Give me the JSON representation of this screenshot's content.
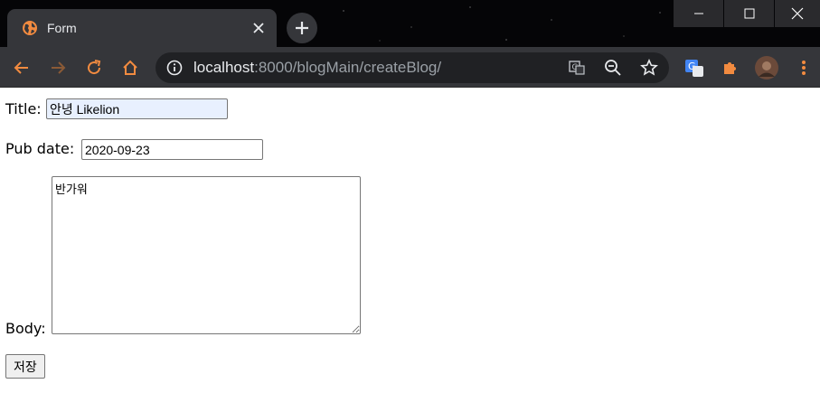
{
  "browser": {
    "tab_title": "Form",
    "url_host": "localhost",
    "url_rest": ":8000/blogMain/createBlog/",
    "colors": {
      "accent": "#f28b40",
      "frame": "#35363a",
      "omnibox": "#202124"
    }
  },
  "form": {
    "title_label": "Title:",
    "title_value": "안녕 Likelion",
    "pub_date_label": "Pub date:",
    "pub_date_value": "2020-09-23",
    "body_label": "Body:",
    "body_value": "반가워",
    "submit_label": "저장"
  }
}
